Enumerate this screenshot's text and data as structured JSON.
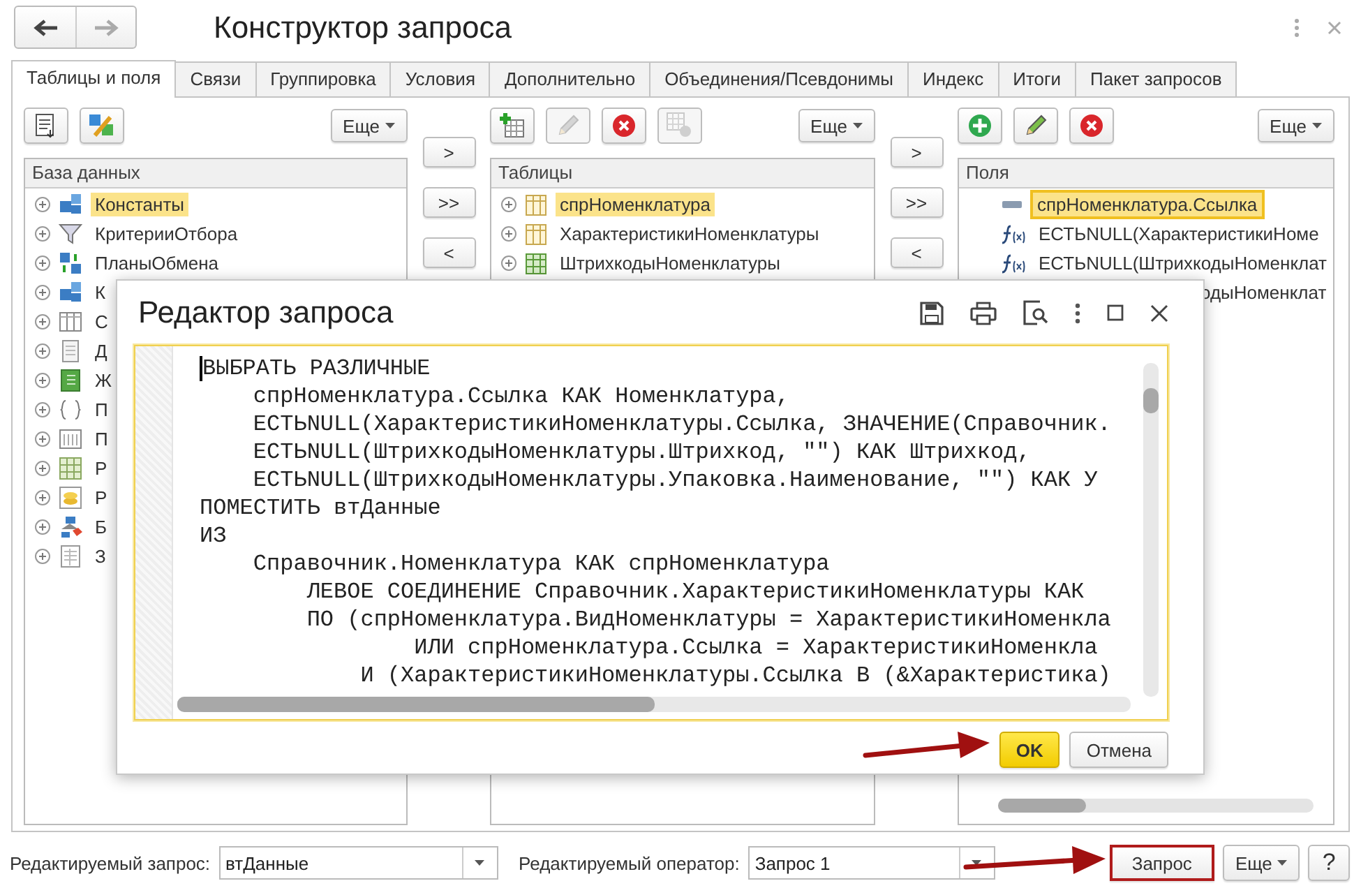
{
  "window": {
    "title": "Конструктор запроса"
  },
  "tabs": [
    {
      "label": "Таблицы и поля",
      "selected": true
    },
    {
      "label": "Связи",
      "selected": false
    },
    {
      "label": "Группировка",
      "selected": false
    },
    {
      "label": "Условия",
      "selected": false
    },
    {
      "label": "Дополнительно",
      "selected": false
    },
    {
      "label": "Объединения/Псевдонимы",
      "selected": false
    },
    {
      "label": "Индекс",
      "selected": false
    },
    {
      "label": "Итоги",
      "selected": false
    },
    {
      "label": "Пакет запросов",
      "selected": false
    }
  ],
  "panels": [
    {
      "title": "База данных",
      "more_button": "Еще",
      "toolbar": [
        {
          "kind": "list",
          "disabled": false
        },
        {
          "kind": "wizard",
          "disabled": false
        }
      ],
      "items": [
        {
          "label": "Константы",
          "selected": true
        },
        {
          "label": "КритерииОтбора",
          "selected": false
        },
        {
          "label": "ПланыОбмена",
          "selected": false
        },
        {
          "label": "К",
          "selected": false
        },
        {
          "label": "С",
          "selected": false
        },
        {
          "label": "Д",
          "selected": false
        },
        {
          "label": "Ж",
          "selected": false
        },
        {
          "label": "П",
          "selected": false
        },
        {
          "label": "П",
          "selected": false
        },
        {
          "label": "Р",
          "selected": false
        },
        {
          "label": "Р",
          "selected": false
        },
        {
          "label": "Б",
          "selected": false
        },
        {
          "label": "З",
          "selected": false
        }
      ]
    },
    {
      "title": "Таблицы",
      "more_button": "Еще",
      "toolbar": [
        {
          "kind": "add-table",
          "disabled": false
        },
        {
          "kind": "edit",
          "disabled": true
        },
        {
          "kind": "delete",
          "disabled": false
        },
        {
          "kind": "settings",
          "disabled": true
        }
      ],
      "items": [
        {
          "label": "спрНоменклатура",
          "selected": true
        },
        {
          "label": "ХарактеристикиНоменклатуры",
          "selected": false
        },
        {
          "label": "ШтрихкодыНоменклатуры",
          "selected": false
        }
      ]
    },
    {
      "title": "Поля",
      "more_button": "Еще",
      "toolbar": [
        {
          "kind": "add",
          "disabled": false
        },
        {
          "kind": "edit",
          "disabled": false
        },
        {
          "kind": "delete",
          "disabled": false
        }
      ],
      "items": [
        {
          "label": "спрНоменклатура.Ссылка",
          "selected": true,
          "kind": "field"
        },
        {
          "label": "ЕСТЬNULL(ХарактеристикиНоме",
          "selected": false,
          "kind": "expression"
        },
        {
          "label": "ЕСТЬNULL(ШтрихкодыНоменклат",
          "selected": false,
          "kind": "expression"
        },
        {
          "label": "одыНоменклат",
          "selected": false,
          "kind": "partial"
        }
      ]
    }
  ],
  "move_buttons": [
    {
      "labels": [
        ">",
        ">>",
        "<"
      ]
    },
    {
      "labels": [
        ">",
        ">>",
        "<"
      ]
    }
  ],
  "dialog": {
    "title": "Редактор запроса",
    "code_lines": [
      "ВЫБРАТЬ РАЗЛИЧНЫЕ",
      "    спрНоменклатура.Ссылка КАК Номенклатура,",
      "    ЕСТЬNULL(ХарактеристикиНоменклатуры.Ссылка, ЗНАЧЕНИЕ(Справочник.",
      "    ЕСТЬNULL(ШтрихкодыНоменклатуры.Штрихкод, \"\") КАК Штрихкод,",
      "    ЕСТЬNULL(ШтрихкодыНоменклатуры.Упаковка.Наименование, \"\") КАК У",
      "ПОМЕСТИТЬ втДанные",
      "ИЗ",
      "    Справочник.Номенклатура КАК спрНоменклатура",
      "        ЛЕВОЕ СОЕДИНЕНИЕ Справочник.ХарактеристикиНоменклатуры КАК",
      "        ПО (спрНоменклатура.ВидНоменклатуры = ХарактеристикиНоменкла",
      "                ИЛИ спрНоменклатура.Ссылка = ХарактеристикиНоменкла",
      "            И (ХарактеристикиНоменклатуры.Ссылка В (&Характеристика)"
    ],
    "buttons": [
      {
        "label": "OK",
        "kind": "default"
      },
      {
        "label": "Отмена",
        "kind": "normal"
      }
    ]
  },
  "bottom_bar": {
    "query_label": "Редактируемый запрос:",
    "query_value": "втДанные",
    "operator_label": "Редактируемый оператор:",
    "operator_value": "Запрос 1",
    "buttons": [
      {
        "label": "Запрос",
        "kind": "highlighted"
      },
      {
        "label": "Еще",
        "kind": "menu"
      },
      {
        "label": "?",
        "kind": "help"
      }
    ]
  }
}
